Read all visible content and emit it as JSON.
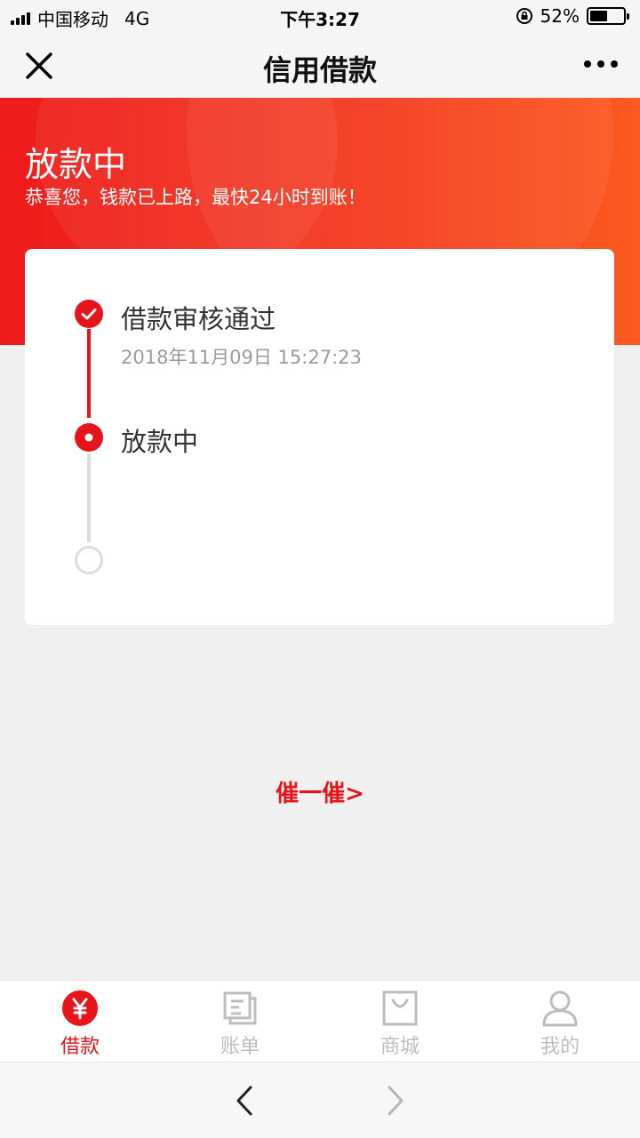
{
  "status_bar": {
    "carrier": "中国移动",
    "network": "4G",
    "time": "下午3:27",
    "battery_percent": "52%",
    "battery_level": 0.52
  },
  "nav": {
    "title": "信用借款",
    "close_icon": "close-icon",
    "more_icon": "more-icon"
  },
  "banner": {
    "title": "放款中",
    "subtitle": "恭喜您，钱款已上路，最快24小时到账！"
  },
  "steps": [
    {
      "title": "借款审核通过",
      "time": "2018年11月09日 15:27:23",
      "state": "done"
    },
    {
      "title": "放款中",
      "time": "",
      "state": "current"
    },
    {
      "title": "",
      "time": "",
      "state": "pending"
    }
  ],
  "urge_link": "催一催>",
  "tabs": [
    {
      "label": "借款",
      "icon": "yuan-icon",
      "active": true
    },
    {
      "label": "账单",
      "icon": "bill-icon",
      "active": false
    },
    {
      "label": "商城",
      "icon": "shop-bag-icon",
      "active": false
    },
    {
      "label": "我的",
      "icon": "user-icon",
      "active": false
    }
  ],
  "colors": {
    "accent": "#e8141b",
    "tab_inactive": "#bdbdbd",
    "line_inactive": "#dddddd"
  }
}
